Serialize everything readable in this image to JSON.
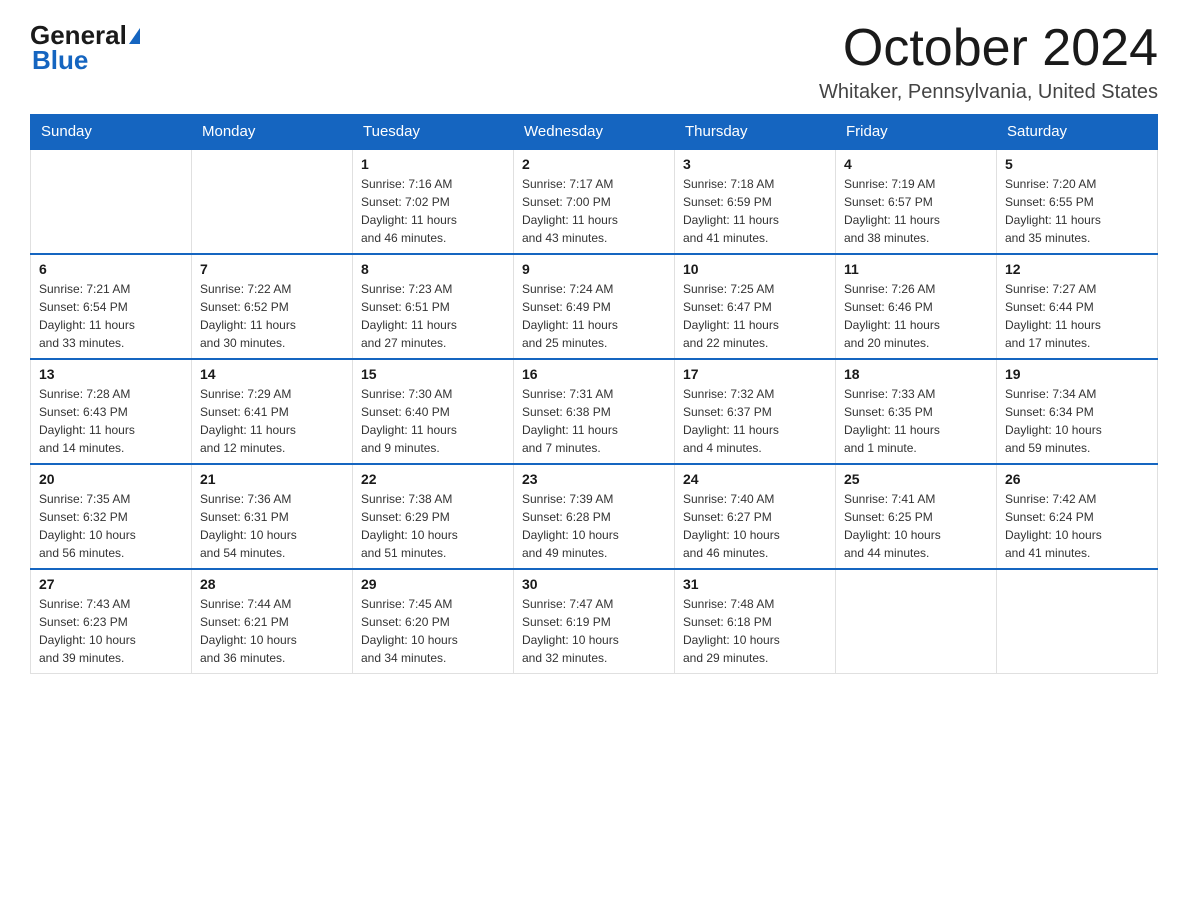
{
  "header": {
    "logo_general": "General",
    "logo_blue": "Blue",
    "month_title": "October 2024",
    "location": "Whitaker, Pennsylvania, United States"
  },
  "weekdays": [
    "Sunday",
    "Monday",
    "Tuesday",
    "Wednesday",
    "Thursday",
    "Friday",
    "Saturday"
  ],
  "weeks": [
    [
      {
        "day": "",
        "info": ""
      },
      {
        "day": "",
        "info": ""
      },
      {
        "day": "1",
        "info": "Sunrise: 7:16 AM\nSunset: 7:02 PM\nDaylight: 11 hours\nand 46 minutes."
      },
      {
        "day": "2",
        "info": "Sunrise: 7:17 AM\nSunset: 7:00 PM\nDaylight: 11 hours\nand 43 minutes."
      },
      {
        "day": "3",
        "info": "Sunrise: 7:18 AM\nSunset: 6:59 PM\nDaylight: 11 hours\nand 41 minutes."
      },
      {
        "day": "4",
        "info": "Sunrise: 7:19 AM\nSunset: 6:57 PM\nDaylight: 11 hours\nand 38 minutes."
      },
      {
        "day": "5",
        "info": "Sunrise: 7:20 AM\nSunset: 6:55 PM\nDaylight: 11 hours\nand 35 minutes."
      }
    ],
    [
      {
        "day": "6",
        "info": "Sunrise: 7:21 AM\nSunset: 6:54 PM\nDaylight: 11 hours\nand 33 minutes."
      },
      {
        "day": "7",
        "info": "Sunrise: 7:22 AM\nSunset: 6:52 PM\nDaylight: 11 hours\nand 30 minutes."
      },
      {
        "day": "8",
        "info": "Sunrise: 7:23 AM\nSunset: 6:51 PM\nDaylight: 11 hours\nand 27 minutes."
      },
      {
        "day": "9",
        "info": "Sunrise: 7:24 AM\nSunset: 6:49 PM\nDaylight: 11 hours\nand 25 minutes."
      },
      {
        "day": "10",
        "info": "Sunrise: 7:25 AM\nSunset: 6:47 PM\nDaylight: 11 hours\nand 22 minutes."
      },
      {
        "day": "11",
        "info": "Sunrise: 7:26 AM\nSunset: 6:46 PM\nDaylight: 11 hours\nand 20 minutes."
      },
      {
        "day": "12",
        "info": "Sunrise: 7:27 AM\nSunset: 6:44 PM\nDaylight: 11 hours\nand 17 minutes."
      }
    ],
    [
      {
        "day": "13",
        "info": "Sunrise: 7:28 AM\nSunset: 6:43 PM\nDaylight: 11 hours\nand 14 minutes."
      },
      {
        "day": "14",
        "info": "Sunrise: 7:29 AM\nSunset: 6:41 PM\nDaylight: 11 hours\nand 12 minutes."
      },
      {
        "day": "15",
        "info": "Sunrise: 7:30 AM\nSunset: 6:40 PM\nDaylight: 11 hours\nand 9 minutes."
      },
      {
        "day": "16",
        "info": "Sunrise: 7:31 AM\nSunset: 6:38 PM\nDaylight: 11 hours\nand 7 minutes."
      },
      {
        "day": "17",
        "info": "Sunrise: 7:32 AM\nSunset: 6:37 PM\nDaylight: 11 hours\nand 4 minutes."
      },
      {
        "day": "18",
        "info": "Sunrise: 7:33 AM\nSunset: 6:35 PM\nDaylight: 11 hours\nand 1 minute."
      },
      {
        "day": "19",
        "info": "Sunrise: 7:34 AM\nSunset: 6:34 PM\nDaylight: 10 hours\nand 59 minutes."
      }
    ],
    [
      {
        "day": "20",
        "info": "Sunrise: 7:35 AM\nSunset: 6:32 PM\nDaylight: 10 hours\nand 56 minutes."
      },
      {
        "day": "21",
        "info": "Sunrise: 7:36 AM\nSunset: 6:31 PM\nDaylight: 10 hours\nand 54 minutes."
      },
      {
        "day": "22",
        "info": "Sunrise: 7:38 AM\nSunset: 6:29 PM\nDaylight: 10 hours\nand 51 minutes."
      },
      {
        "day": "23",
        "info": "Sunrise: 7:39 AM\nSunset: 6:28 PM\nDaylight: 10 hours\nand 49 minutes."
      },
      {
        "day": "24",
        "info": "Sunrise: 7:40 AM\nSunset: 6:27 PM\nDaylight: 10 hours\nand 46 minutes."
      },
      {
        "day": "25",
        "info": "Sunrise: 7:41 AM\nSunset: 6:25 PM\nDaylight: 10 hours\nand 44 minutes."
      },
      {
        "day": "26",
        "info": "Sunrise: 7:42 AM\nSunset: 6:24 PM\nDaylight: 10 hours\nand 41 minutes."
      }
    ],
    [
      {
        "day": "27",
        "info": "Sunrise: 7:43 AM\nSunset: 6:23 PM\nDaylight: 10 hours\nand 39 minutes."
      },
      {
        "day": "28",
        "info": "Sunrise: 7:44 AM\nSunset: 6:21 PM\nDaylight: 10 hours\nand 36 minutes."
      },
      {
        "day": "29",
        "info": "Sunrise: 7:45 AM\nSunset: 6:20 PM\nDaylight: 10 hours\nand 34 minutes."
      },
      {
        "day": "30",
        "info": "Sunrise: 7:47 AM\nSunset: 6:19 PM\nDaylight: 10 hours\nand 32 minutes."
      },
      {
        "day": "31",
        "info": "Sunrise: 7:48 AM\nSunset: 6:18 PM\nDaylight: 10 hours\nand 29 minutes."
      },
      {
        "day": "",
        "info": ""
      },
      {
        "day": "",
        "info": ""
      }
    ]
  ]
}
